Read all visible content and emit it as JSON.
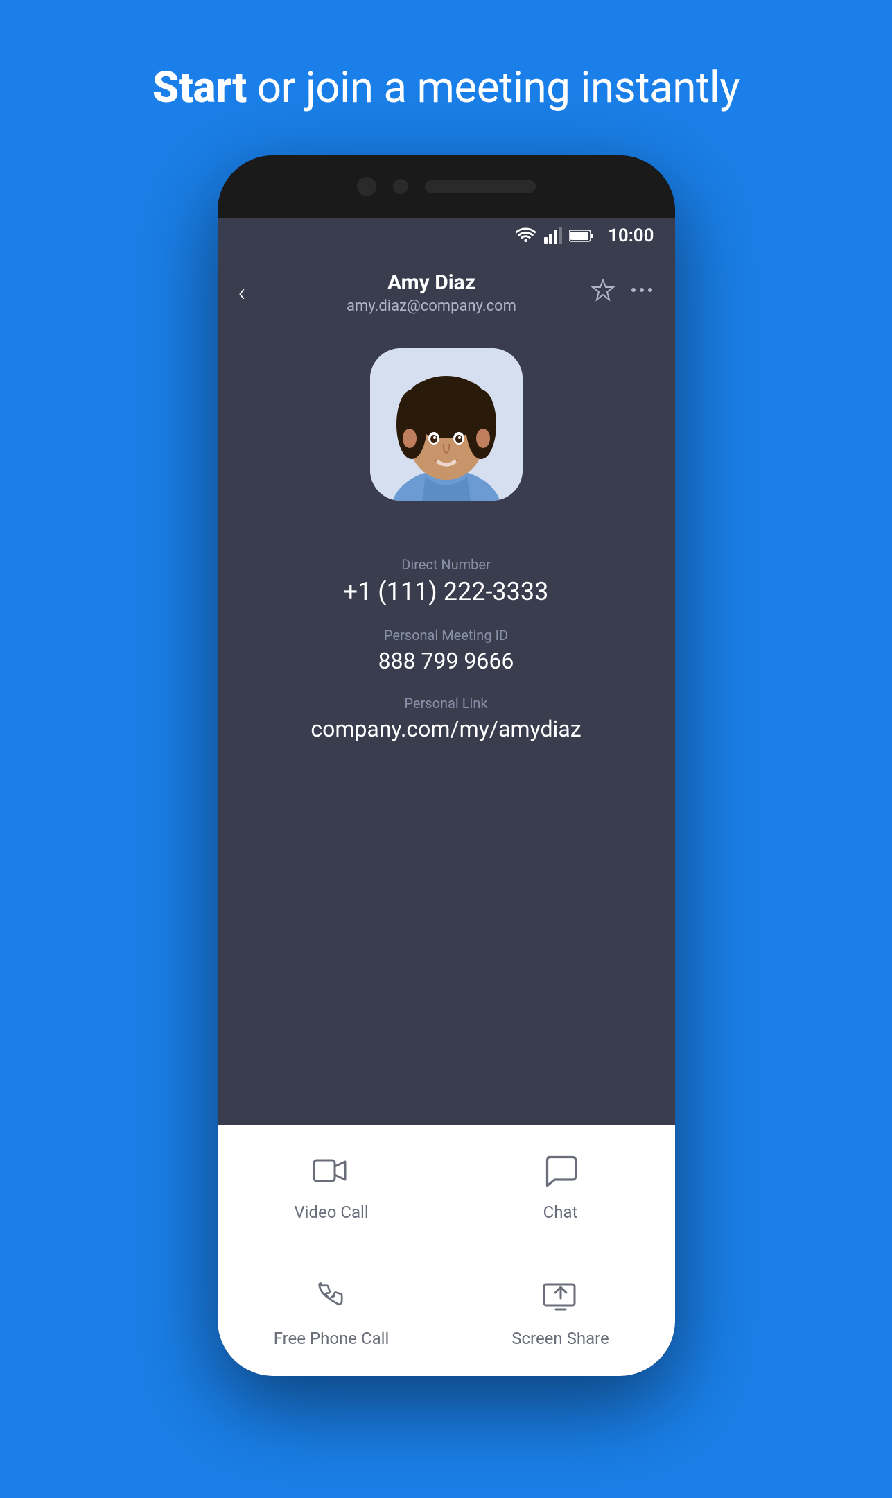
{
  "hero": {
    "text_bold": "Start",
    "text_regular": " or join a meeting instantly"
  },
  "status_bar": {
    "time": "10:00"
  },
  "contact_header": {
    "back_label": "‹",
    "name": "Amy Diaz",
    "email": "amy.diaz@company.com",
    "star_label": "☆",
    "more_label": "···"
  },
  "contact_info": {
    "direct_number_label": "Direct Number",
    "direct_number_value": "+1 (111) 222-3333",
    "meeting_id_label": "Personal Meeting ID",
    "meeting_id_value": "888 799 9666",
    "personal_link_label": "Personal Link",
    "personal_link_value": "company.com/my/amydiaz"
  },
  "actions": [
    {
      "id": "video-call",
      "label": "Video Call"
    },
    {
      "id": "chat",
      "label": "Chat"
    },
    {
      "id": "free-phone-call",
      "label": "Free Phone Call"
    },
    {
      "id": "screen-share",
      "label": "Screen Share"
    }
  ]
}
